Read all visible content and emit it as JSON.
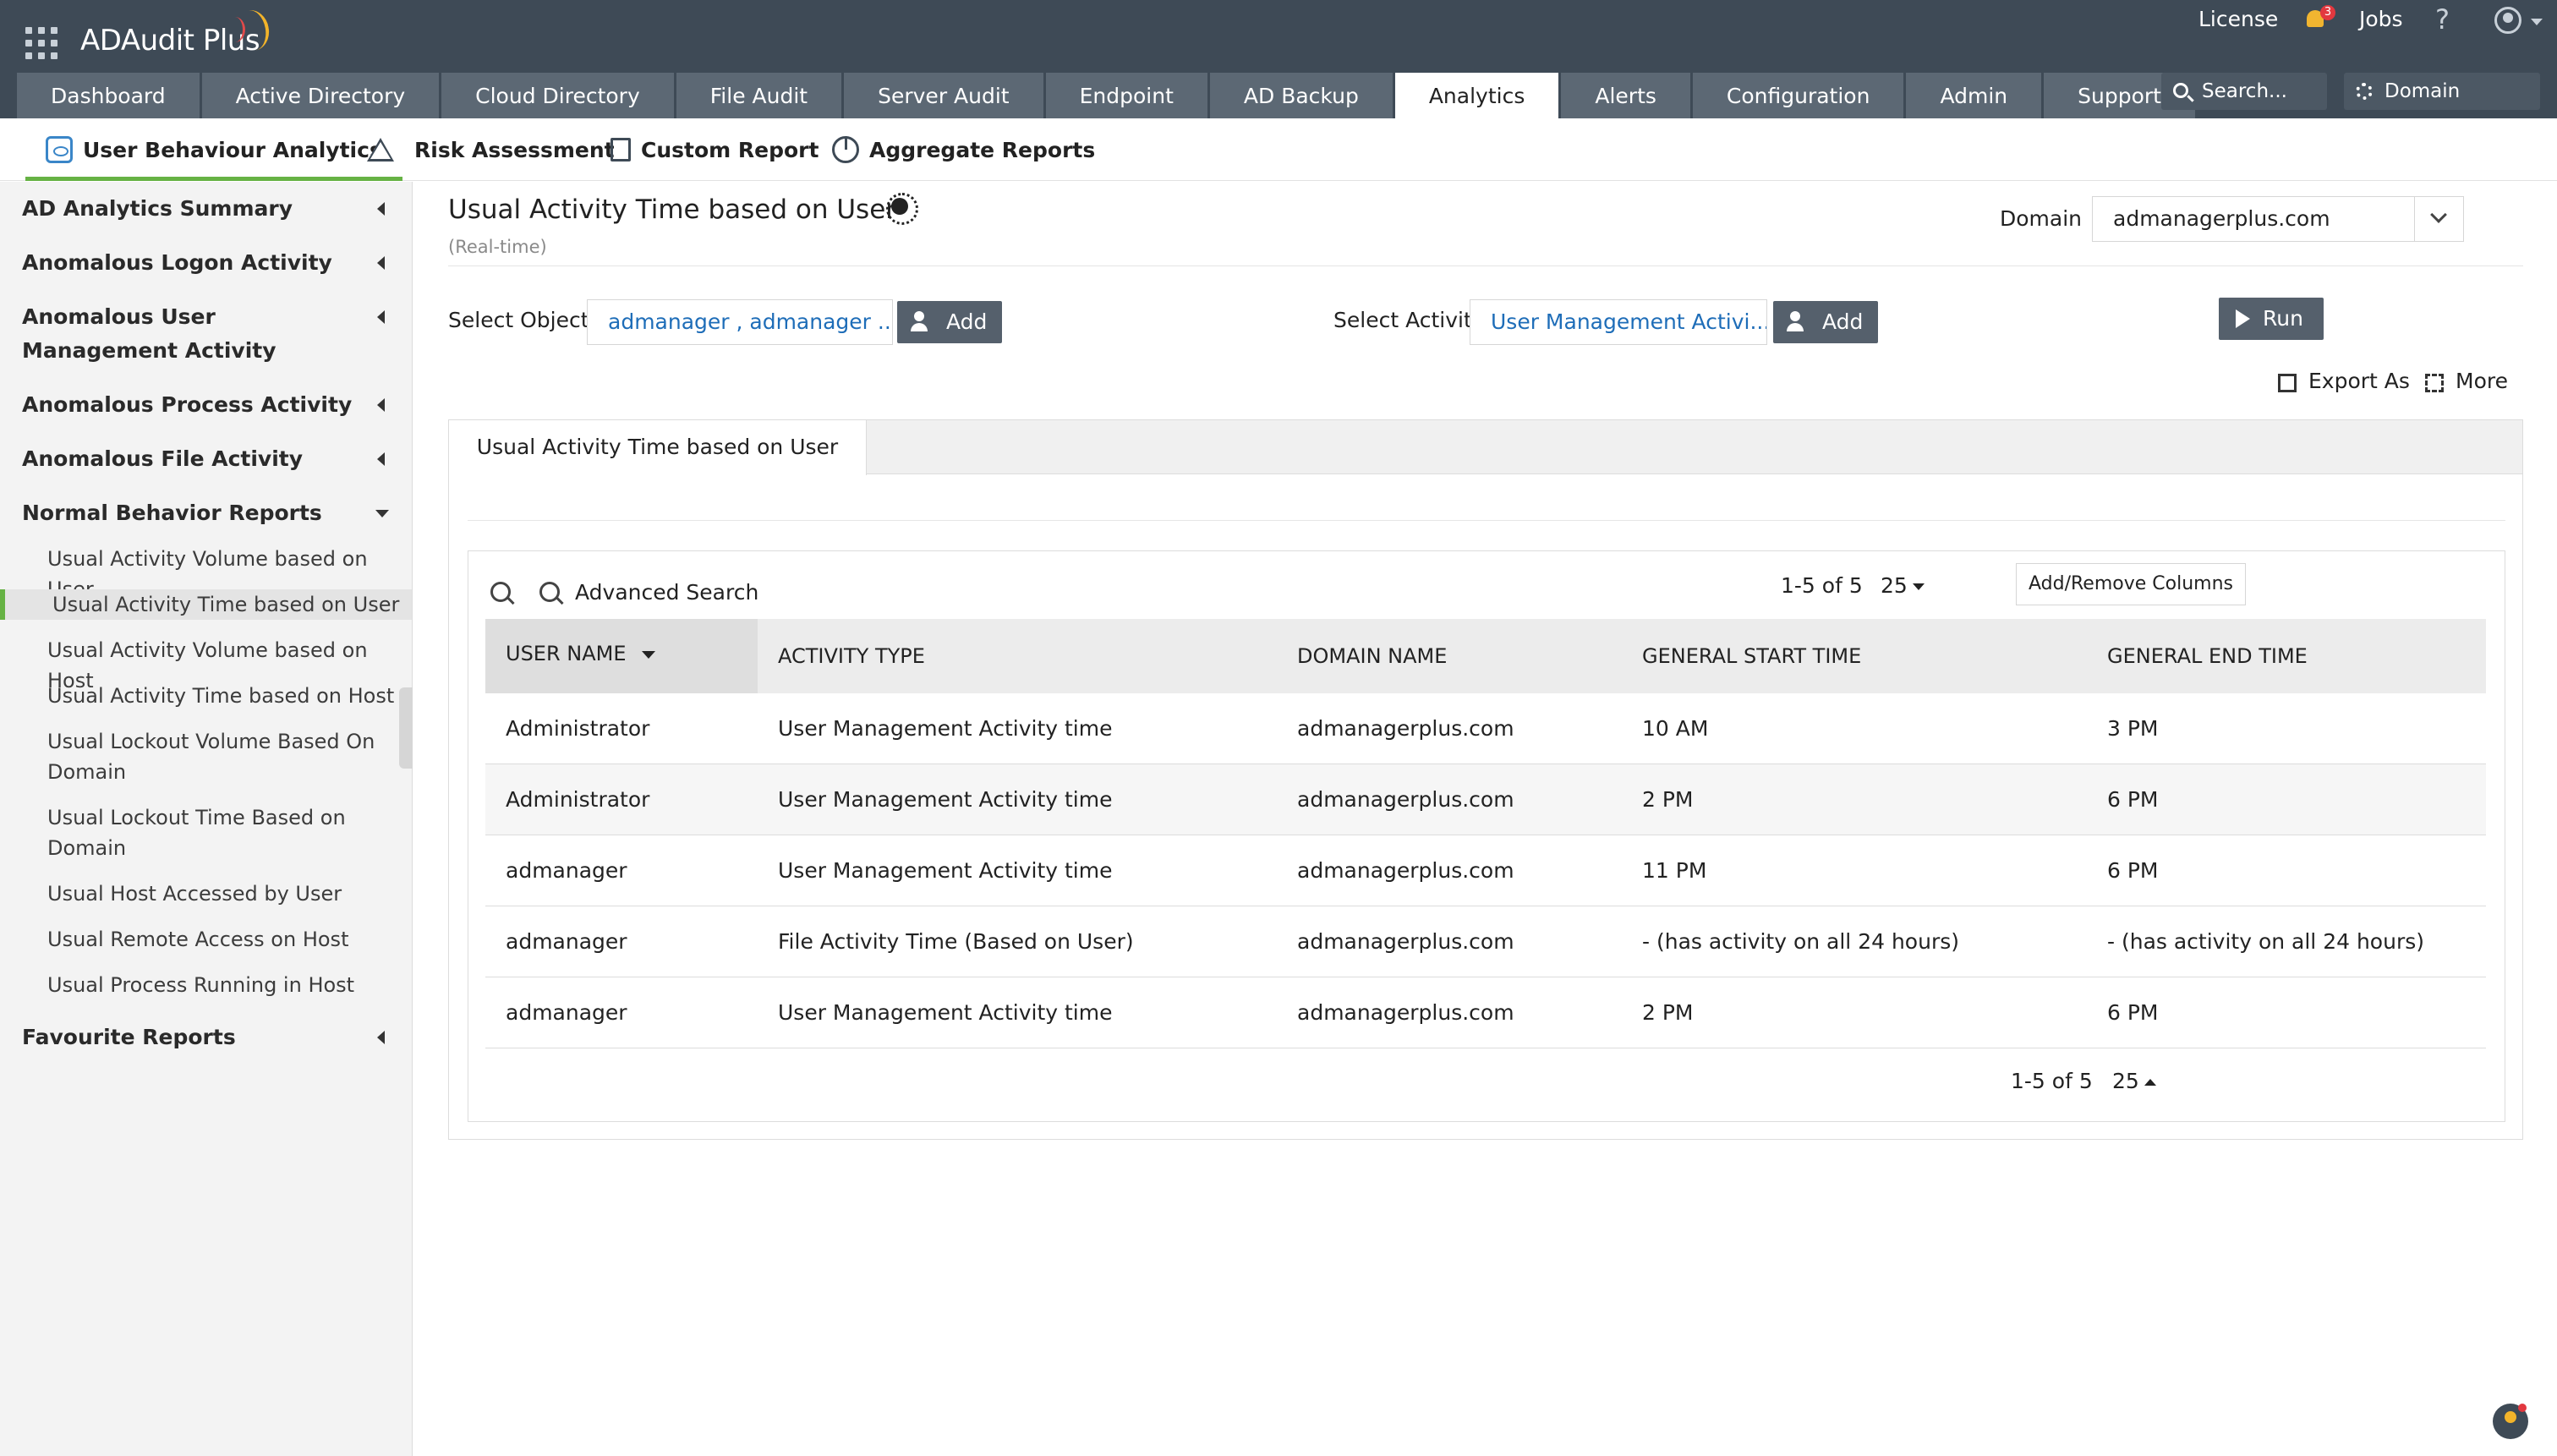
{
  "app": {
    "brand": "ADAudit Plus",
    "colors": {
      "topbar": "#3e4a56",
      "tab": "#5c6874",
      "accent_green": "#66b244",
      "link_blue": "#1e6db8"
    }
  },
  "topbar": {
    "license": "License",
    "notification_count": "3",
    "jobs": "Jobs",
    "help": "?",
    "search_placeholder": "Search...",
    "domain_settings": "Domain Settings"
  },
  "tabs": [
    {
      "label": "Dashboard"
    },
    {
      "label": "Active Directory"
    },
    {
      "label": "Cloud Directory"
    },
    {
      "label": "File Audit"
    },
    {
      "label": "Server Audit"
    },
    {
      "label": "Endpoint"
    },
    {
      "label": "AD Backup"
    },
    {
      "label": "Analytics",
      "active": true
    },
    {
      "label": "Alerts"
    },
    {
      "label": "Configuration"
    },
    {
      "label": "Admin"
    },
    {
      "label": "Support"
    }
  ],
  "subnav": [
    {
      "label": "User Behaviour Analytics",
      "icon": "eye-icon",
      "active": true
    },
    {
      "label": "Risk Assessment",
      "icon": "warning-icon"
    },
    {
      "label": "Custom Report",
      "icon": "custom-report-icon"
    },
    {
      "label": "Aggregate Reports",
      "icon": "pie-chart-icon"
    }
  ],
  "sidebar": {
    "groups": [
      {
        "label": "AD Analytics Summary"
      },
      {
        "label": "Anomalous Logon Activity"
      },
      {
        "label": "Anomalous User Management Activity"
      },
      {
        "label": "Anomalous Process Activity"
      },
      {
        "label": "Anomalous File Activity"
      },
      {
        "label": "Normal Behavior Reports",
        "expanded": true
      },
      {
        "label": "Favourite Reports"
      }
    ],
    "items": [
      {
        "label": "Usual Activity Volume based on User"
      },
      {
        "label": "Usual Activity Time based on User",
        "active": true
      },
      {
        "label": "Usual Activity Volume based on Host"
      },
      {
        "label": "Usual Activity Time based on Host"
      },
      {
        "label": "Usual Lockout Volume Based On Domain"
      },
      {
        "label": "Usual Lockout Time Based on Domain"
      },
      {
        "label": "Usual Host Accessed by User"
      },
      {
        "label": "Usual Remote Access on Host"
      },
      {
        "label": "Usual Process Running in Host"
      }
    ]
  },
  "main": {
    "title": "Usual Activity Time based on User",
    "subtitle": "(Real-time)",
    "domain_label": "Domain",
    "domain_value": "admanagerplus.com",
    "select_objects_label": "Select Objects",
    "select_objects_value": "admanager , admanager ...",
    "select_activity_label": "Select Activity",
    "select_activity_value": "User Management Activi...",
    "add_label": "Add",
    "run_label": "Run",
    "export_label": "Export As",
    "more_label": "More",
    "report_tab": "Usual Activity Time based on User"
  },
  "table": {
    "advanced_search": "Advanced Search",
    "range": "1-5 of 5",
    "page_size": "25",
    "add_remove_columns": "Add/Remove Columns",
    "columns": [
      "USER NAME",
      "ACTIVITY TYPE",
      "DOMAIN NAME",
      "GENERAL START TIME",
      "GENERAL END TIME"
    ],
    "rows": [
      [
        "Administrator",
        "User Management Activity time",
        "admanagerplus.com",
        "10 AM",
        "3 PM"
      ],
      [
        "Administrator",
        "User Management Activity time",
        "admanagerplus.com",
        "2 PM",
        "6 PM"
      ],
      [
        "admanager",
        "User Management Activity time",
        "admanagerplus.com",
        "11 PM",
        "6 PM"
      ],
      [
        "admanager",
        "File Activity Time (Based on User)",
        "admanagerplus.com",
        "- (has activity on all 24 hours)",
        "- (has activity on all 24 hours)"
      ],
      [
        "admanager",
        "User Management Activity time",
        "admanagerplus.com",
        "2 PM",
        "6 PM"
      ]
    ]
  }
}
